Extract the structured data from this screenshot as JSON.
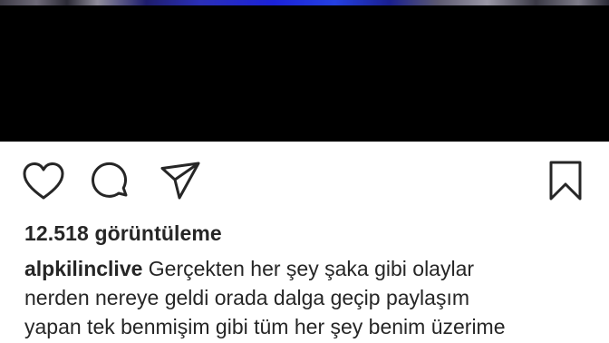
{
  "post": {
    "username": "alpkilinclive",
    "views_text": "12.518 görüntüleme",
    "caption_lines": [
      "Gerçekten her şey şaka gibi olaylar",
      "nerden nereye geldi orada dalga geçip paylaşım",
      "yapan tek benmişim gibi tüm her şey benim üzerime"
    ]
  },
  "actions": {
    "icons": [
      "heart-icon",
      "comment-icon",
      "share-icon",
      "bookmark-icon"
    ]
  },
  "colors": {
    "text": "#262626",
    "media_background": "#000000"
  }
}
